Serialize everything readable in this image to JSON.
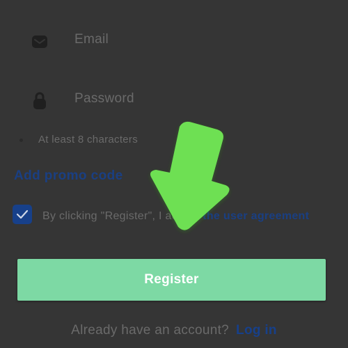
{
  "form": {
    "email_placeholder": "Email",
    "password_placeholder": "Password",
    "password_hint": "At least 8 characters",
    "promo_link": "Add promo code",
    "agreement_text": "By clicking \"Register\", I accept ",
    "agreement_link": "the user agreement",
    "register_button": "Register",
    "login_prompt": "Already have an account?",
    "login_link": "Log in"
  },
  "icons": {
    "email": "envelope-icon",
    "password": "lock-icon",
    "checkbox": "check-icon",
    "overlay": "arrow-down-icon"
  },
  "colors": {
    "background": "#353535",
    "link": "#1a3f82",
    "button": "#7dd9a4",
    "arrow": "#6ee052"
  }
}
